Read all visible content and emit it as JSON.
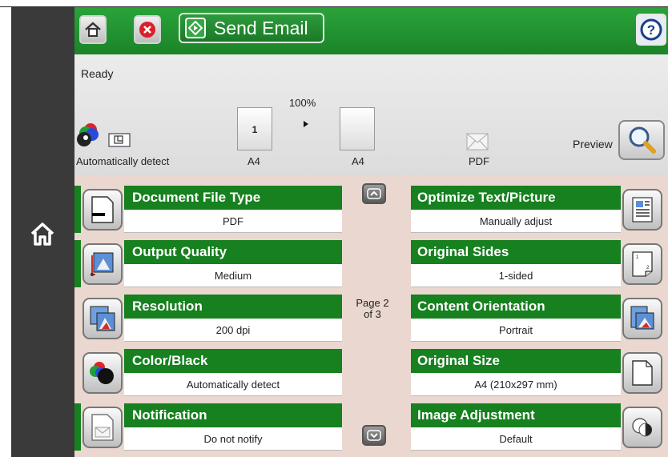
{
  "header": {
    "home_icon": "home-icon",
    "cancel_icon": "cancel-icon",
    "send_label": "Send Email",
    "send_icon": "start-icon",
    "help_icon": "help-icon"
  },
  "status": {
    "state": "Ready",
    "zoom": "100%",
    "color_mode": "Automatically detect",
    "original_size": "A4",
    "output_size": "A4",
    "page_number": "1",
    "file_type": "PDF",
    "preview_label": "Preview"
  },
  "pagination": {
    "line1": "Page 2",
    "line2": "of 3"
  },
  "options_left": [
    {
      "title": "Document File Type",
      "value": "PDF"
    },
    {
      "title": "Output Quality",
      "value": "Medium"
    },
    {
      "title": "Resolution",
      "value": "200 dpi"
    },
    {
      "title": "Color/Black",
      "value": "Automatically detect"
    },
    {
      "title": "Notification",
      "value": "Do not notify"
    }
  ],
  "options_right": [
    {
      "title": "Optimize Text/Picture",
      "value": "Manually adjust"
    },
    {
      "title": "Original Sides",
      "value": "1-sided"
    },
    {
      "title": "Content Orientation",
      "value": "Portrait"
    },
    {
      "title": "Original Size",
      "value": "A4 (210x297 mm)"
    },
    {
      "title": "Image Adjustment",
      "value": "Default"
    }
  ],
  "colors": {
    "header_green": "#1b8428",
    "tile_green": "#17801f",
    "panel_bg": "#ead8d0",
    "sidebar": "#3a3a3a"
  }
}
